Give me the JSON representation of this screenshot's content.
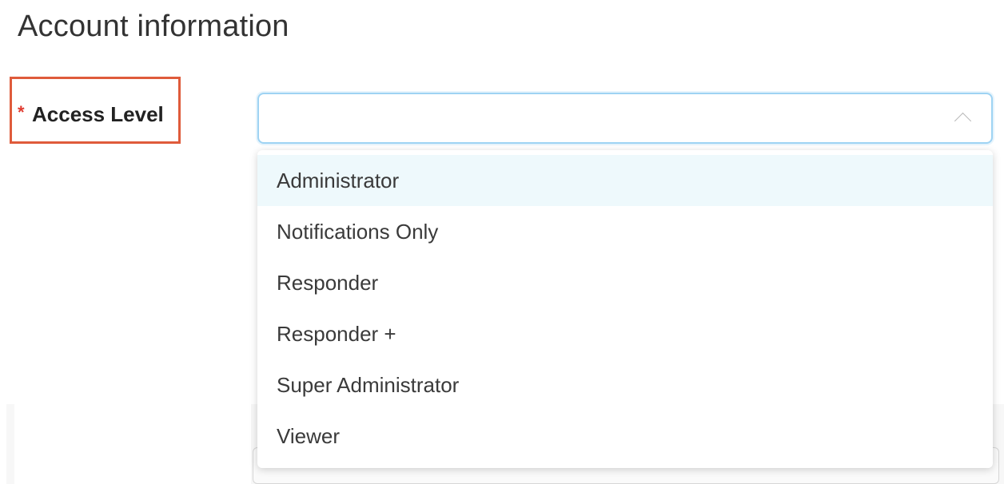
{
  "section": {
    "title": "Account information"
  },
  "access_level": {
    "required_mark": "*",
    "label": "Access Level",
    "value": "",
    "dropdown_open": true,
    "options": [
      "Administrator",
      "Notifications Only",
      "Responder",
      "Responder +",
      "Super Administrator",
      "Viewer"
    ],
    "highlighted_option": "Administrator"
  },
  "colors": {
    "highlight_border": "#df5b3b",
    "required": "#e03a2f",
    "focus_border": "#9ed3f3",
    "option_hover": "#eef9fc"
  },
  "icons": {
    "select_toggle": "chevron-up-icon"
  }
}
